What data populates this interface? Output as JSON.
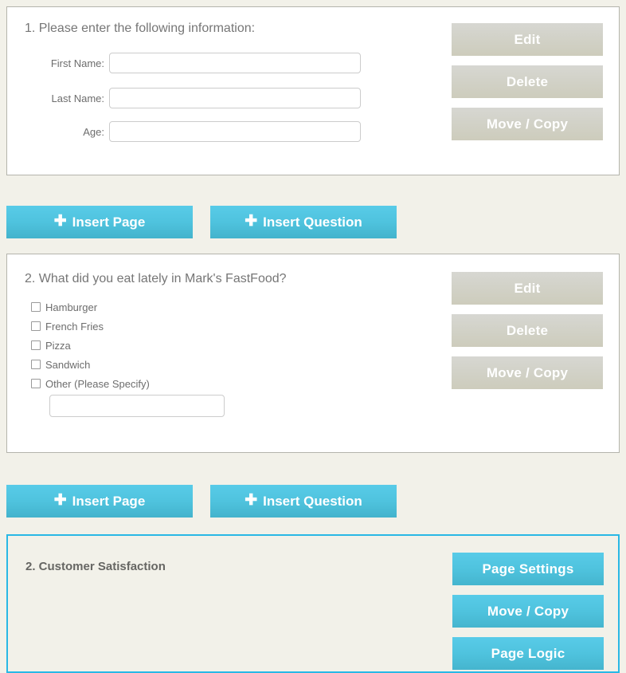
{
  "page": {
    "background_color": "#f2f1e9",
    "accent_blue": "#4fc3de",
    "button_gray": "#d2d2c8",
    "panel_border": "#b4b4ac",
    "page_border": "#29b8e5"
  },
  "questions": [
    {
      "title": "1. Please enter the following information:",
      "type": "text-fields",
      "fields": [
        {
          "label": "First Name:",
          "value": "",
          "placeholder": ""
        },
        {
          "label": "Last Name:",
          "value": "",
          "placeholder": ""
        },
        {
          "label": "Age:",
          "value": "",
          "placeholder": ""
        }
      ],
      "actions": [
        {
          "label": "Edit",
          "style": "gray"
        },
        {
          "label": "Delete",
          "style": "gray"
        },
        {
          "label": "Move / Copy",
          "style": "gray"
        }
      ]
    },
    {
      "title": "2. What did you eat lately in Mark's FastFood?",
      "type": "checkbox-list",
      "options": [
        {
          "label": "Hamburger",
          "checked": false
        },
        {
          "label": "French Fries",
          "checked": false
        },
        {
          "label": "Pizza",
          "checked": false
        },
        {
          "label": "Sandwich",
          "checked": false
        },
        {
          "label": "Other (Please Specify)",
          "checked": false
        }
      ],
      "other_input": {
        "value": "",
        "placeholder": ""
      },
      "actions": [
        {
          "label": "Edit",
          "style": "gray"
        },
        {
          "label": "Delete",
          "style": "gray"
        },
        {
          "label": "Move / Copy",
          "style": "gray"
        }
      ]
    }
  ],
  "insert_rows": [
    {
      "page_label": "Insert Page",
      "question_label": "Insert Question",
      "icon": "plus-icon"
    },
    {
      "page_label": "Insert Page",
      "question_label": "Insert Question",
      "icon": "plus-icon"
    }
  ],
  "page_section": {
    "title": "2. Customer Satisfaction",
    "actions": [
      {
        "label": "Page Settings",
        "style": "blue"
      },
      {
        "label": "Move / Copy",
        "style": "blue"
      },
      {
        "label": "Page Logic",
        "style": "blue"
      }
    ]
  }
}
